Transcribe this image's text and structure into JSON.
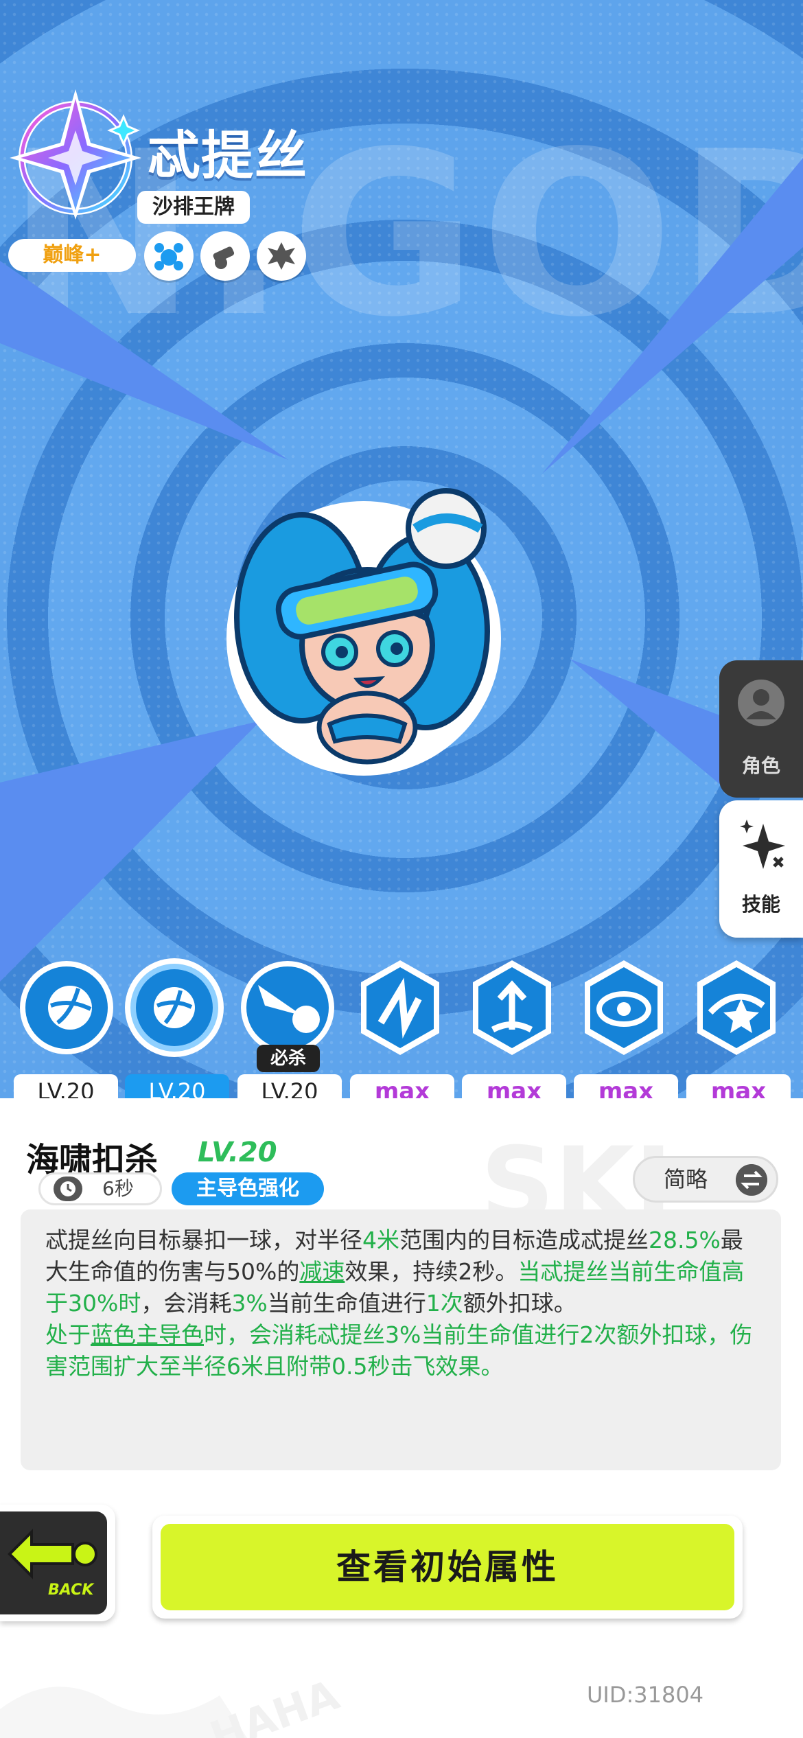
{
  "character": {
    "name": "忒提丝",
    "subtitle": "沙排王牌",
    "rank": "巅峰+",
    "role_icons": [
      "paw-icon",
      "cannon-icon",
      "spiky-shield-icon"
    ]
  },
  "watermark": "N.GOD",
  "side_menu": {
    "role_label": "角色",
    "skill_label": "技能"
  },
  "skills": [
    {
      "icon": "volleyball-icon",
      "level": "LV.20"
    },
    {
      "icon": "volleyball-target-icon",
      "level": "LV.20"
    },
    {
      "icon": "spike-ball-icon",
      "level": "LV.20",
      "tag": "必杀"
    },
    {
      "icon": "star-burst-icon",
      "level": "max"
    },
    {
      "icon": "fountain-arrow-icon",
      "level": "max"
    },
    {
      "icon": "vortex-eye-icon",
      "level": "max"
    },
    {
      "icon": "spin-star-icon",
      "level": "max"
    }
  ],
  "detail": {
    "title": "海啸扣杀",
    "level": "LV.20",
    "cooldown": "6秒",
    "tag": "主导色强化",
    "brief_label": "简略",
    "description": {
      "p1_a": "忒提丝向目标暴扣一球，对半径",
      "p1_b": "4米",
      "p1_c": "范围内的目标造成忒提丝",
      "p1_d": "28.5%",
      "p1_e": "最大生命值的伤害与50%的",
      "p1_f": "减速",
      "p1_g": "效果，持续2秒。",
      "p1_h": "当忒提丝当前生命值高于30%时",
      "p1_i": "，会消耗",
      "p1_j": "3%",
      "p1_k": "当前生命值进行",
      "p1_l": "1次",
      "p1_m": "额外扣球。",
      "p2_a": "处于",
      "p2_b": "蓝色主导色",
      "p2_c": "时，会消耗忒提丝3%当前生命值进行2次额外扣球，伤害范围扩大至半径6米且附带0.5秒击飞效果。"
    }
  },
  "actions": {
    "back_label": "BACK",
    "main_button": "查看初始属性"
  },
  "uid": "UID:31804",
  "colors": {
    "accent_lime": "#d8f52a",
    "accent_blue": "#1c9bf0",
    "highlight_green": "#22b04a",
    "max_purple": "#b33ad8"
  }
}
